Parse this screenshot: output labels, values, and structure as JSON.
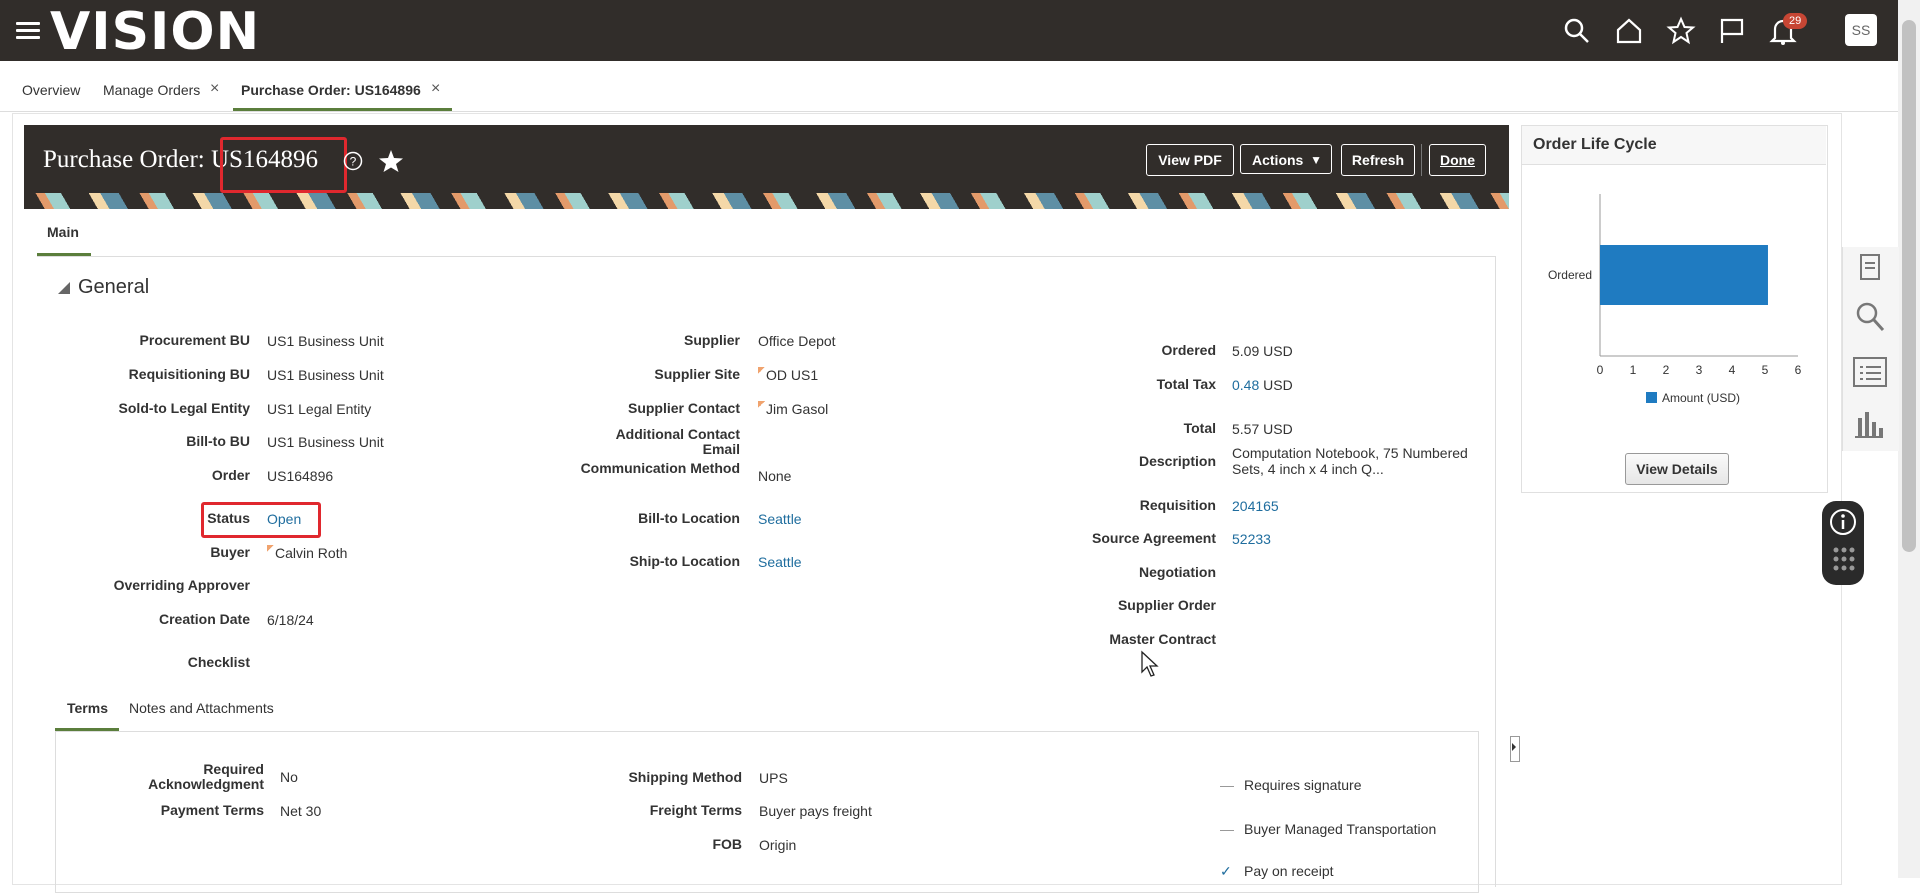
{
  "app": {
    "logo": "VISION",
    "notification_count": "29",
    "user_initials": "SS"
  },
  "tabs": [
    {
      "label": "Overview"
    },
    {
      "label": "Manage Orders"
    },
    {
      "label": "Purchase Order: US164896"
    }
  ],
  "page": {
    "title_prefix": "Purchase Order: ",
    "order_number": "US164896",
    "buttons": {
      "view_pdf": "View PDF",
      "actions": "Actions",
      "refresh": "Refresh",
      "done": "Done"
    },
    "main_tab": "Main",
    "section": "General"
  },
  "general": {
    "col1": [
      {
        "label": "Procurement BU",
        "value": "US1 Business Unit"
      },
      {
        "label": "Requisitioning BU",
        "value": "US1 Business Unit"
      },
      {
        "label": "Sold-to Legal Entity",
        "value": "US1 Legal Entity"
      },
      {
        "label": "Bill-to BU",
        "value": "US1 Business Unit"
      },
      {
        "label": "Order",
        "value": "US164896"
      },
      {
        "label": "Status",
        "value": "Open"
      },
      {
        "label": "Buyer",
        "value": "Calvin Roth"
      },
      {
        "label": "Overriding Approver",
        "value": ""
      },
      {
        "label": "Creation Date",
        "value": "6/18/24"
      },
      {
        "label": "Checklist",
        "value": ""
      }
    ],
    "col2": [
      {
        "label": "Supplier",
        "value": "Office Depot"
      },
      {
        "label": "Supplier Site",
        "value": "OD US1"
      },
      {
        "label": "Supplier Contact",
        "value": "Jim Gasol"
      },
      {
        "label": "Additional Contact Email",
        "value": ""
      },
      {
        "label": "Communication Method",
        "value": "None"
      },
      {
        "label": "Bill-to Location",
        "value": "Seattle"
      },
      {
        "label": "Ship-to Location",
        "value": "Seattle"
      }
    ],
    "col3": [
      {
        "label": "Ordered",
        "value": "5.09",
        "unit": "USD"
      },
      {
        "label": "Total Tax",
        "value": "0.48",
        "unit": "USD"
      },
      {
        "label": "Total",
        "value": "5.57",
        "unit": "USD"
      },
      {
        "label": "Description",
        "value": "Computation Notebook, 75 Numbered Sets, 4 inch x 4 inch Q..."
      },
      {
        "label": "Requisition",
        "value": "204165"
      },
      {
        "label": "Source Agreement",
        "value": "52233"
      },
      {
        "label": "Negotiation",
        "value": ""
      },
      {
        "label": "Supplier Order",
        "value": ""
      },
      {
        "label": "Master Contract",
        "value": ""
      }
    ]
  },
  "subtabs": [
    {
      "label": "Terms"
    },
    {
      "label": "Notes and Attachments"
    }
  ],
  "terms": {
    "col1": [
      {
        "label": "Required Acknowledgment",
        "value": "No"
      },
      {
        "label": "Payment Terms",
        "value": "Net 30"
      }
    ],
    "col2": [
      {
        "label": "Shipping Method",
        "value": "UPS"
      },
      {
        "label": "Freight Terms",
        "value": "Buyer pays freight"
      },
      {
        "label": "FOB",
        "value": "Origin"
      }
    ],
    "checks": [
      {
        "label": "Requires signature",
        "checked": false
      },
      {
        "label": "Buyer Managed Transportation",
        "checked": false
      },
      {
        "label": "Pay on receipt",
        "checked": true
      }
    ]
  },
  "lifecycle": {
    "title": "Order Life Cycle",
    "view_details": "View Details",
    "chart_data": {
      "type": "bar",
      "orientation": "horizontal",
      "categories": [
        "Ordered"
      ],
      "series": [
        {
          "name": "Amount (USD)",
          "values": [
            5.09
          ]
        }
      ],
      "xlim": [
        0,
        6
      ],
      "xticks": [
        "0",
        "1",
        "2",
        "3",
        "4",
        "5",
        "6"
      ],
      "legend": "bottom",
      "bar_color": "#1f7bc1"
    }
  },
  "colors": {
    "header_bg": "#312d2a",
    "accent": "#5b7e3c",
    "link": "#1f6d9e",
    "highlight": "#e0282e"
  }
}
